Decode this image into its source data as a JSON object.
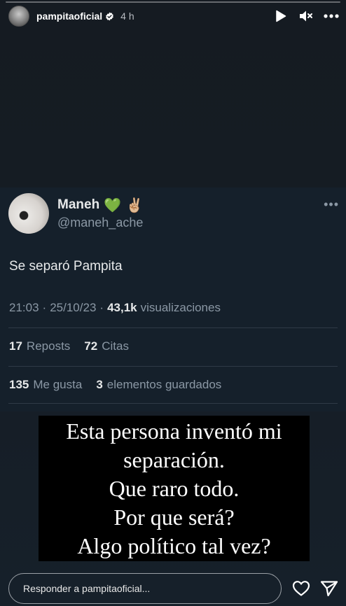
{
  "story": {
    "progress": 0.0,
    "username": "pampitaoficial",
    "time": "4 h",
    "icons": {
      "play": "play-icon",
      "mute": "mute-icon",
      "more": "more-icon",
      "verified": "verified-badge-icon"
    }
  },
  "tweet": {
    "name": "Maneh",
    "emojis": "💚 ✌🏼",
    "handle": "@maneh_ache",
    "text": "Se separó Pampita",
    "meta": {
      "time": "21:03",
      "dot1": "·",
      "date": "25/10/23",
      "dot2": "·",
      "views_count": "43,1k",
      "views_label": "visualizaciones"
    },
    "stats1": {
      "reposts_count": "17",
      "reposts_label": "Reposts",
      "quotes_count": "72",
      "quotes_label": "Citas"
    },
    "stats2": {
      "likes_count": "135",
      "likes_label": "Me gusta",
      "saved_count": "3",
      "saved_label": "elementos guardados"
    },
    "more": "•••"
  },
  "overlay": {
    "lines": [
      "Esta persona inventó mi",
      "separación.",
      "Que raro todo.",
      "Por que será?",
      "Algo político tal vez?"
    ]
  },
  "footer": {
    "reply_placeholder": "Responder a pampitaoficial...",
    "icons": {
      "like": "heart-icon",
      "share": "send-icon"
    }
  }
}
